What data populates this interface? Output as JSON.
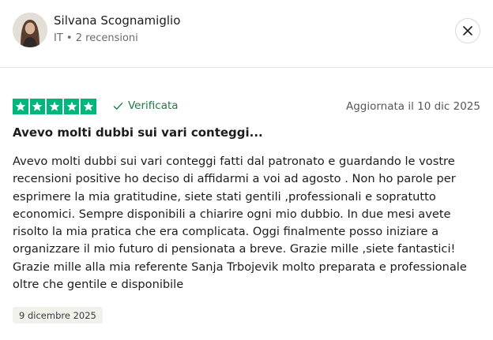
{
  "reviewer": {
    "name": "Silvana Scognamiglio",
    "country": "IT",
    "separator": "•",
    "reviews_count": "2 recensioni"
  },
  "review": {
    "rating": 5,
    "rating_max": 5,
    "verified_label": "Verificata",
    "updated_label": "Aggiornata il 10 dic 2025",
    "title": "Avevo molti dubbi sui vari conteggi...",
    "body_lines": [
      "Avevo molti dubbi sui vari conteggi fatti dal patronato e guardando le vostre",
      "recensioni positive ho deciso di affidarmi a voi ad agosto . Non ho parole per",
      "esprimere la mia gratitudine, siete stati gentili ,professionali e sopratutto",
      "economici. Sempre disponibili a chiarire ogni mio dubbio. In due mesi avete",
      "risolto la mia pratica che era complicata. Oggi finalmente posso iniziare a",
      "organizzare il mio futuro di pensionata a breve. Grazie mille ,siete fantastici!",
      "Grazie mille alla mia referente Sanja Trbojevik molto preparata e professionale",
      "oltre che gentile e disponibile"
    ],
    "experience_date": "9 dicembre 2025"
  },
  "colors": {
    "star": "#00b67a",
    "verified": "#1c7d44"
  },
  "icons": {
    "close": "close-icon",
    "check": "check-icon",
    "star": "star-icon"
  }
}
